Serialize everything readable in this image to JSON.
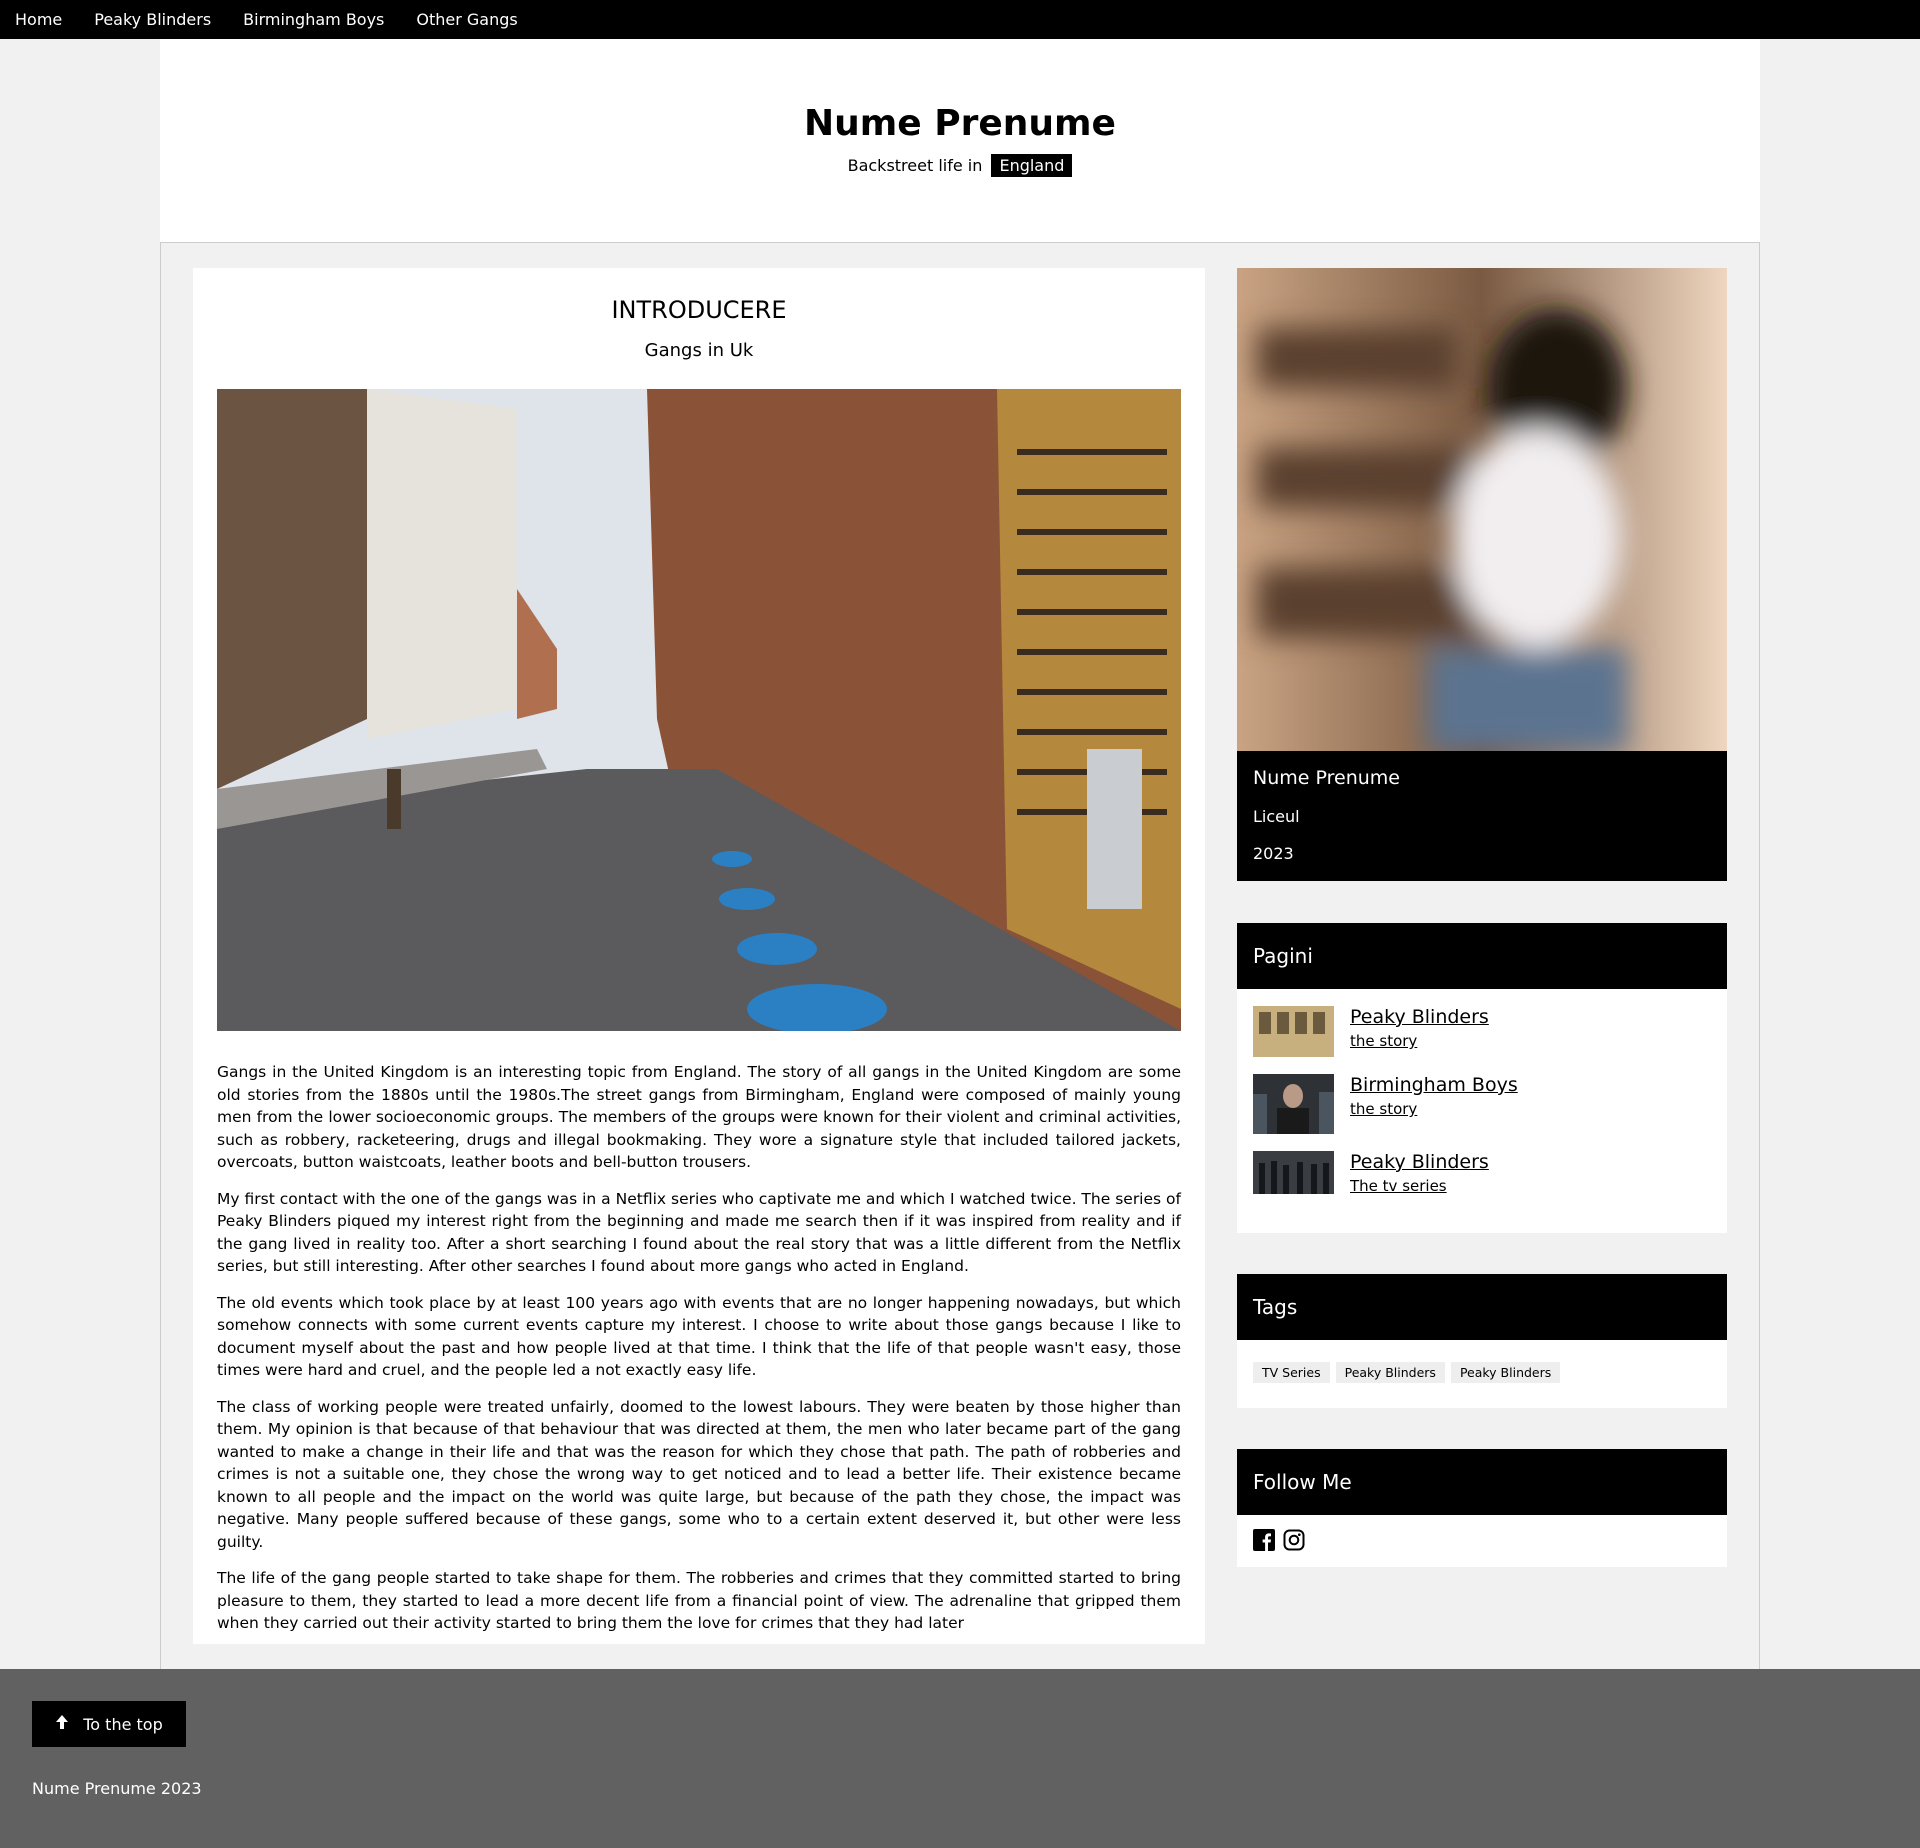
{
  "nav": {
    "items": [
      "Home",
      "Peaky Blinders",
      "Birmingham Boys",
      "Other Gangs"
    ]
  },
  "header": {
    "title": "Nume Prenume",
    "subtitle_prefix": "Backstreet life in",
    "subtitle_tag": "England"
  },
  "article": {
    "title": "INTRODUCERE",
    "subtitle": "Gangs in Uk",
    "paragraphs": [
      "Gangs in the United Kingdom is an interesting topic from England. The story of all gangs in the United Kingdom are some old stories from the 1880s until the 1980s.The street gangs from Birmingham, England were composed of mainly young men from the lower socioeconomic groups. The members of the groups were known for their violent and criminal activities, such as robbery, racketeering, drugs and illegal bookmaking. They wore a signature style that included tailored jackets, overcoats, button waistcoats, leather boots and bell-button trousers.",
      "My first contact with the one of the gangs was in a Netflix series who captivate me and which I watched twice. The series of Peaky Blinders piqued my interest right from the beginning and made me search then if it was inspired from reality and if the gang lived in reality too. After a short searching I found about the real story that was a little different from the Netflix series, but still interesting. After other searches I found about more gangs who acted in England.",
      "The old events which took place by at least 100 years ago with events that are no longer happening nowadays, but which somehow connects with some current events capture my interest. I choose to write about those gangs because I like to document myself about the past and how people lived at that time. I think that the life of that people wasn't easy, those times were hard and cruel, and the people led a not exactly easy life.",
      "The class of working people were treated unfairly, doomed to the lowest labours. They were beaten by those higher than them. My opinion is that because of that behaviour that was directed at them, the men who later became part of the gang wanted to make a change in their life and that was the reason for which they chose that path. The path of robberies and crimes is not a suitable one, they chose the wrong way to get noticed and to lead a better life. Their existence became known to all people and the impact on the world was quite large, but because of the path they chose, the impact was negative. Many people suffered because of these gangs, some who to a certain extent deserved it, but other were less guilty.",
      "The life of the gang people started to take shape for them. The robberies and crimes that they committed started to bring pleasure to them, they started to lead a more decent life from a financial point of view. The adrenaline that gripped them when they carried out their activity started to bring them the love for crimes that they had later"
    ]
  },
  "profile": {
    "name": "Nume Prenume",
    "school": "Liceul",
    "year": "2023"
  },
  "pages": {
    "title": "Pagini",
    "items": [
      {
        "title": "Peaky Blinders",
        "sub": "the story"
      },
      {
        "title": "Birmingham Boys",
        "sub": "the story"
      },
      {
        "title": "Peaky Blinders",
        "sub": "The tv series"
      }
    ]
  },
  "tags": {
    "title": "Tags",
    "items": [
      "TV Series",
      "Peaky Blinders",
      "Peaky Blinders"
    ]
  },
  "follow": {
    "title": "Follow Me",
    "icons": [
      "facebook-icon",
      "instagram-icon"
    ]
  },
  "footer": {
    "top_button": "To the top",
    "copyright": "Nume Prenume 2023"
  }
}
